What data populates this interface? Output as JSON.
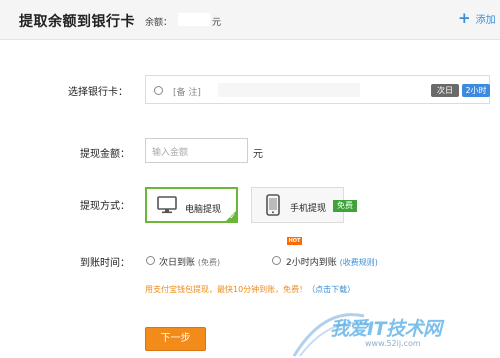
{
  "header": {
    "title": "提取余额到银行卡",
    "balance_label": "余额：",
    "balance_unit": "元",
    "add_label": "添加"
  },
  "bank": {
    "label": "选择银行卡：",
    "note": "[备 注]",
    "tag_next_day": "次日",
    "tag_2h": "2小时"
  },
  "amount": {
    "label": "提现金额：",
    "placeholder": "输入金额",
    "unit": "元"
  },
  "method": {
    "label": "提现方式：",
    "pc": "电脑提现",
    "mobile": "手机提现",
    "free_badge": "免费"
  },
  "arrival": {
    "label": "到账时间：",
    "next_day": "次日到账",
    "next_day_note": "(免费)",
    "two_hours": "2小时内到账",
    "two_hours_link": "(收费规则)",
    "hot": "HOT"
  },
  "promo": {
    "text": "用支付宝钱包提现，最快10分钟到账，免费！",
    "link": "（点击下载）"
  },
  "next_button": "下一步",
  "watermark": {
    "text": "我爱IT技术网",
    "url": "www.52ij.com"
  }
}
